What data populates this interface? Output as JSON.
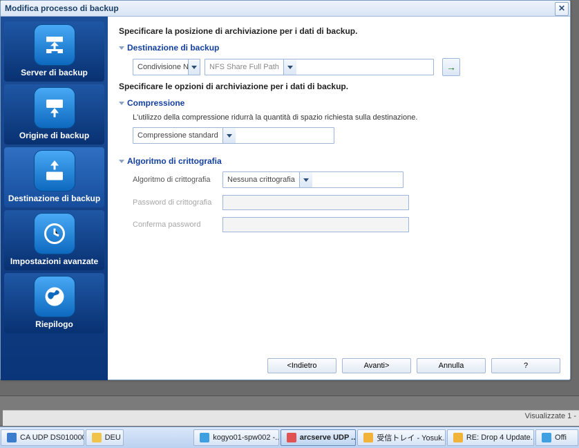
{
  "dialog": {
    "title": "Modifica processo di backup"
  },
  "sidebar": {
    "items": [
      {
        "label": "Server di backup"
      },
      {
        "label": "Origine di backup"
      },
      {
        "label": "Destinazione di backup"
      },
      {
        "label": "Impostazioni avanzate"
      },
      {
        "label": "Riepilogo"
      }
    ]
  },
  "content": {
    "intro1": "Specificare la posizione di archiviazione per i dati di backup.",
    "sect_dest": "Destinazione di backup",
    "dest_type": "Condivisione N",
    "dest_path_placeholder": "NFS Share Full Path",
    "intro2": "Specificare le opzioni di archiviazione per i dati di backup.",
    "sect_comp": "Compressione",
    "comp_desc": "L'utilizzo della compressione ridurrà la quantità di spazio richiesta sulla destinazione.",
    "comp_value": "Compressione standard",
    "sect_enc": "Algoritmo di crittografia",
    "enc_label": "Algoritmo di crittografia",
    "enc_value": "Nessuna crittografia",
    "pwd_label": "Password di crittografia",
    "pwd2_label": "Conferma password"
  },
  "footer": {
    "back": "<Indietro",
    "next": "Avanti>",
    "cancel": "Annulla",
    "help": "?"
  },
  "statusbar": {
    "text": "Visualizzate 1 -"
  },
  "taskbar": {
    "items": [
      {
        "label": "CA UDP DS010000",
        "color": "#3b7dcc"
      },
      {
        "label": "DEU",
        "color": "#f0c34a"
      },
      {
        "label": "kogyo01-spw002 -...",
        "color": "#3ea0e0"
      },
      {
        "label": "arcserve UDP ...",
        "color": "#e15252"
      },
      {
        "label": "受信トレイ - Yosuk...",
        "color": "#f2b33a"
      },
      {
        "label": "RE: Drop 4 Update...",
        "color": "#f2b33a"
      },
      {
        "label": "Offi",
        "color": "#3ea0e0"
      }
    ]
  }
}
